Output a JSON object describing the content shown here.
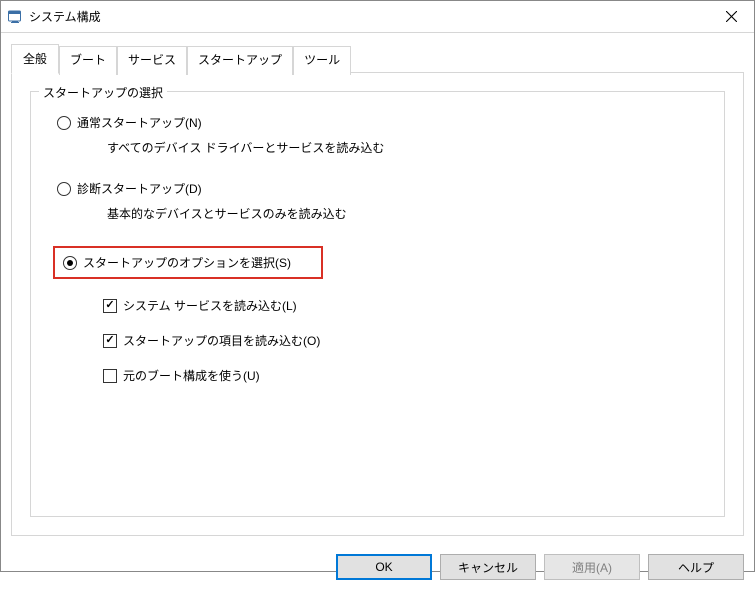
{
  "window": {
    "title": "システム構成"
  },
  "tabs": {
    "general": "全般",
    "boot": "ブート",
    "services": "サービス",
    "startup": "スタートアップ",
    "tools": "ツール"
  },
  "fieldset": {
    "legend": "スタートアップの選択"
  },
  "radios": {
    "normal": {
      "label": "通常スタートアップ(N)",
      "desc": "すべてのデバイス ドライバーとサービスを読み込む"
    },
    "diagnostic": {
      "label": "診断スタートアップ(D)",
      "desc": "基本的なデバイスとサービスのみを読み込む"
    },
    "selective": {
      "label": "スタートアップのオプションを選択(S)"
    }
  },
  "checkboxes": {
    "loadSystemServices": "システム サービスを読み込む(L)",
    "loadStartupItems": "スタートアップの項目を読み込む(O)",
    "useOriginalBoot": "元のブート構成を使う(U)"
  },
  "buttons": {
    "ok": "OK",
    "cancel": "キャンセル",
    "apply": "適用(A)",
    "help": "ヘルプ"
  }
}
